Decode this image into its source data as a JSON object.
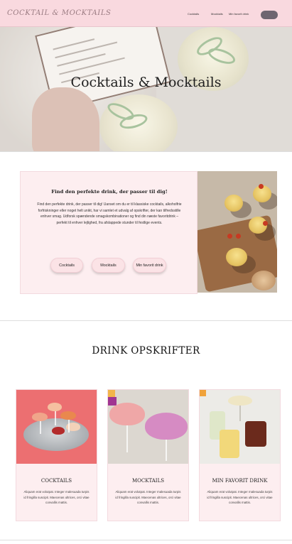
{
  "header": {
    "brand": "COCKTAIL & MOCKTAILS",
    "nav_1": "Cocktails",
    "nav_2": "Mocktails",
    "nav_3": "Min favorit drink"
  },
  "hero": {
    "title": "Cocktails & Mocktails"
  },
  "intro": {
    "title": "Find den perfekte drink, der passer til dig!",
    "text": "Find den perfekte drink, der passer til dig! Uanset om du er til klassiske cocktails, alkoholfrie forfriskninger eller noget helt unikt, har vi samlet et udvalg af opskrifter, der kan tilfredsstille enhver smag. Udforsk spændende smagskombinationer og find din næste favoritdrink – perfekt til enhver lejlighed, fra afslappede stunder til festlige events.",
    "buttons": [
      "Cocktails",
      "Mocktails",
      "Min favorit drink"
    ]
  },
  "recipes": {
    "title": "DRINK OPSKRIFTER",
    "cards": [
      {
        "title": "COCKTAILS",
        "text": "Aliquam erat volutpat. Integer malesuada turpis id fringilla suscipit. Maecenas ultrices, orci vitae convallis mattis."
      },
      {
        "title": "MOCKTAILS",
        "text": "Aliquam erat volutpat. Integer malesuada turpis id fringilla suscipit. Maecenas ultrices, orci vitae convallis mattis."
      },
      {
        "title": "MIN FAVORIT DRINK",
        "text": "Aliquam erat volutpat. Integer malesuada turpis id fringilla suscipit. Maecenas ultrices, orci vitae convallis mattis."
      }
    ]
  },
  "colors": {
    "header_bg": "#f9d9df",
    "card_bg": "#fdeef0",
    "button_dark": "#6e6570"
  }
}
